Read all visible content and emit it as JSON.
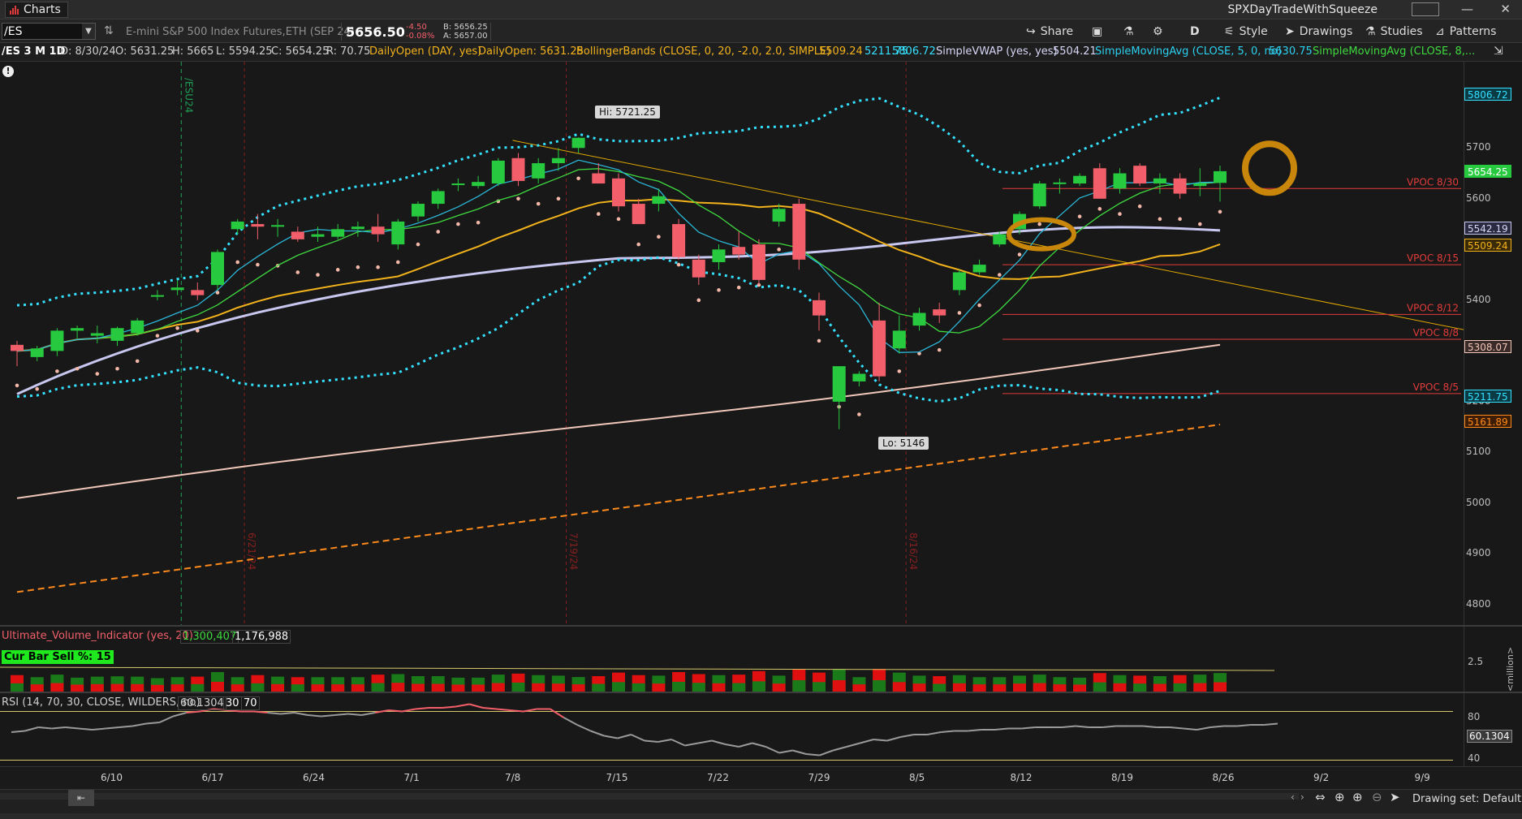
{
  "window": {
    "app_title": "Charts",
    "layout_name": "SPXDayTradeWithSqueeze",
    "minimize": "—",
    "close": "✕"
  },
  "toolbar": {
    "symbol": "/ES",
    "description": "E-mini S&P 500 Index Futures,ETH (SEP 24)",
    "last": "5656.50",
    "change": "-4.50",
    "change_pct": "-0.08%",
    "bid": "B: 5656.25",
    "ask": "A: 5657.00",
    "share": "Share",
    "period": "D",
    "style": "Style",
    "drawings": "Drawings",
    "studies": "Studies",
    "patterns": "Patterns"
  },
  "studybar": {
    "aggregation": "/ES 3 M 1D",
    "date": "D: 8/30/24",
    "open": "O: 5631.25",
    "high": "H: 5665",
    "low": "L: 5594.25",
    "close": "C: 5654.25",
    "range": "R: 70.75",
    "daily_open_study": "DailyOpen (DAY, yes)",
    "daily_open_value": "DailyOpen: 5631.25",
    "bb_study": "BollingerBands (CLOSE, 0, 20, -2.0, 2.0, SIMPLE)",
    "bb_mid": "5509.24",
    "bb_low": "5211.75",
    "bb_up": "5806.72",
    "vwap_study": "SimpleVWAP (yes, yes)",
    "vwap_value": "5504.21",
    "sma5_study": "SimpleMovingAvg (CLOSE, 5, 0, no)",
    "sma5_value": "5630.75",
    "sma8_study": "SimpleMovingAvg (CLOSE, 8,..."
  },
  "annotations": {
    "hi": "Hi: 5721.25",
    "lo": "Lo: 5146",
    "expiry": "/ESU24",
    "v1": "6/21/24",
    "v2": "7/19/24",
    "v3": "8/16/24",
    "alert": "!"
  },
  "vpoc": [
    {
      "label": "VPOC 8/30",
      "price": 5620
    },
    {
      "label": "VPOC 8/15",
      "price": 5470
    },
    {
      "label": "VPOC 8/12",
      "price": 5372
    },
    {
      "label": "VPOC 8/8",
      "price": 5323
    },
    {
      "label": "VPOC 8/5",
      "price": 5216
    }
  ],
  "price_axis": {
    "ticks": [
      5800,
      5700,
      5600,
      5500,
      5400,
      5300,
      5200,
      5100,
      5000,
      4900,
      4800
    ],
    "tags": [
      {
        "text": "5806.72",
        "price": 5806.72,
        "bg": "#0a3a44",
        "fg": "#34e1ff",
        "border": "#34e1ff"
      },
      {
        "text": "5654.25",
        "price": 5654.25,
        "bg": "#27c93f",
        "fg": "#ffffff",
        "border": "#27c93f"
      },
      {
        "text": "5542.19",
        "price": 5542.19,
        "bg": "#2a2a40",
        "fg": "#d6d6f6",
        "border": "#c7c7ef"
      },
      {
        "text": "5509.24",
        "price": 5509.24,
        "bg": "#3a2a05",
        "fg": "#f2b21c",
        "border": "#f2b21c"
      },
      {
        "text": "5308.07",
        "price": 5308.07,
        "bg": "#3a2a28",
        "fg": "#f0c6b8",
        "border": "#f0c6b8"
      },
      {
        "text": "5211.75",
        "price": 5211.75,
        "bg": "#0a3a44",
        "fg": "#34e1ff",
        "border": "#34e1ff"
      },
      {
        "text": "5161.89",
        "price": 5161.89,
        "bg": "#3d1e05",
        "fg": "#ff8a1c",
        "border": "#ff8a1c"
      }
    ]
  },
  "chart_data": {
    "type": "candlestick",
    "ylim": [
      4760,
      5870
    ],
    "x_labels": [
      "6/10",
      "6/17",
      "6/24",
      "7/1",
      "7/8",
      "7/15",
      "7/22",
      "7/29",
      "8/5",
      "8/12",
      "8/19",
      "8/26",
      "9/2",
      "9/9"
    ],
    "candles": [
      {
        "o": 5312,
        "h": 5320,
        "l": 5270,
        "c": 5300
      },
      {
        "o": 5288,
        "h": 5310,
        "l": 5280,
        "c": 5305
      },
      {
        "o": 5300,
        "h": 5345,
        "l": 5290,
        "c": 5340
      },
      {
        "o": 5340,
        "h": 5350,
        "l": 5325,
        "c": 5345
      },
      {
        "o": 5330,
        "h": 5350,
        "l": 5315,
        "c": 5335
      },
      {
        "o": 5320,
        "h": 5348,
        "l": 5310,
        "c": 5345
      },
      {
        "o": 5335,
        "h": 5365,
        "l": 5330,
        "c": 5360
      },
      {
        "o": 5410,
        "h": 5420,
        "l": 5400,
        "c": 5410
      },
      {
        "o": 5420,
        "h": 5440,
        "l": 5410,
        "c": 5425
      },
      {
        "o": 5420,
        "h": 5435,
        "l": 5400,
        "c": 5410
      },
      {
        "o": 5430,
        "h": 5500,
        "l": 5420,
        "c": 5495
      },
      {
        "o": 5540,
        "h": 5560,
        "l": 5530,
        "c": 5555
      },
      {
        "o": 5550,
        "h": 5570,
        "l": 5520,
        "c": 5545
      },
      {
        "o": 5545,
        "h": 5560,
        "l": 5525,
        "c": 5548
      },
      {
        "o": 5535,
        "h": 5545,
        "l": 5515,
        "c": 5520
      },
      {
        "o": 5525,
        "h": 5545,
        "l": 5515,
        "c": 5530
      },
      {
        "o": 5525,
        "h": 5550,
        "l": 5520,
        "c": 5540
      },
      {
        "o": 5540,
        "h": 5555,
        "l": 5525,
        "c": 5545
      },
      {
        "o": 5545,
        "h": 5570,
        "l": 5515,
        "c": 5530
      },
      {
        "o": 5510,
        "h": 5560,
        "l": 5500,
        "c": 5555
      },
      {
        "o": 5565,
        "h": 5595,
        "l": 5555,
        "c": 5590
      },
      {
        "o": 5590,
        "h": 5620,
        "l": 5580,
        "c": 5615
      },
      {
        "o": 5630,
        "h": 5640,
        "l": 5615,
        "c": 5630
      },
      {
        "o": 5625,
        "h": 5645,
        "l": 5620,
        "c": 5633
      },
      {
        "o": 5630,
        "h": 5680,
        "l": 5625,
        "c": 5675
      },
      {
        "o": 5680,
        "h": 5690,
        "l": 5625,
        "c": 5635
      },
      {
        "o": 5640,
        "h": 5680,
        "l": 5630,
        "c": 5670
      },
      {
        "o": 5670,
        "h": 5700,
        "l": 5655,
        "c": 5680
      },
      {
        "o": 5700,
        "h": 5721,
        "l": 5690,
        "c": 5720
      },
      {
        "o": 5650,
        "h": 5670,
        "l": 5630,
        "c": 5630
      },
      {
        "o": 5640,
        "h": 5650,
        "l": 5575,
        "c": 5585
      },
      {
        "o": 5590,
        "h": 5600,
        "l": 5550,
        "c": 5550
      },
      {
        "o": 5590,
        "h": 5620,
        "l": 5575,
        "c": 5605
      },
      {
        "o": 5550,
        "h": 5560,
        "l": 5480,
        "c": 5485
      },
      {
        "o": 5480,
        "h": 5490,
        "l": 5430,
        "c": 5445
      },
      {
        "o": 5475,
        "h": 5510,
        "l": 5460,
        "c": 5500
      },
      {
        "o": 5505,
        "h": 5535,
        "l": 5480,
        "c": 5490
      },
      {
        "o": 5510,
        "h": 5520,
        "l": 5430,
        "c": 5440
      },
      {
        "o": 5555,
        "h": 5590,
        "l": 5545,
        "c": 5580
      },
      {
        "o": 5590,
        "h": 5600,
        "l": 5460,
        "c": 5480
      },
      {
        "o": 5400,
        "h": 5415,
        "l": 5340,
        "c": 5370
      },
      {
        "o": 5200,
        "h": 5262,
        "l": 5146,
        "c": 5270
      },
      {
        "o": 5240,
        "h": 5260,
        "l": 5230,
        "c": 5255
      },
      {
        "o": 5360,
        "h": 5395,
        "l": 5240,
        "c": 5250
      },
      {
        "o": 5305,
        "h": 5370,
        "l": 5295,
        "c": 5340
      },
      {
        "o": 5350,
        "h": 5385,
        "l": 5340,
        "c": 5375
      },
      {
        "o": 5382,
        "h": 5395,
        "l": 5355,
        "c": 5370
      },
      {
        "o": 5420,
        "h": 5460,
        "l": 5410,
        "c": 5455
      },
      {
        "o": 5455,
        "h": 5480,
        "l": 5450,
        "c": 5470
      },
      {
        "o": 5510,
        "h": 5535,
        "l": 5505,
        "c": 5530
      },
      {
        "o": 5540,
        "h": 5575,
        "l": 5530,
        "c": 5570
      },
      {
        "o": 5585,
        "h": 5635,
        "l": 5580,
        "c": 5630
      },
      {
        "o": 5630,
        "h": 5640,
        "l": 5610,
        "c": 5632
      },
      {
        "o": 5630,
        "h": 5650,
        "l": 5625,
        "c": 5645
      },
      {
        "o": 5660,
        "h": 5670,
        "l": 5600,
        "c": 5600
      },
      {
        "o": 5620,
        "h": 5660,
        "l": 5610,
        "c": 5650
      },
      {
        "o": 5665,
        "h": 5670,
        "l": 5625,
        "c": 5630
      },
      {
        "o": 5630,
        "h": 5650,
        "l": 5610,
        "c": 5640
      },
      {
        "o": 5640,
        "h": 5650,
        "l": 5600,
        "c": 5610
      },
      {
        "o": 5625,
        "h": 5660,
        "l": 5605,
        "c": 5630
      },
      {
        "o": 5631.25,
        "h": 5665,
        "l": 5594.25,
        "c": 5654.25
      }
    ]
  },
  "volume_panel": {
    "study": "Ultimate_Volume_Indicator (yes, 20)",
    "v1": "1,300,407",
    "v2": "1,176,988",
    "cur_bar": "Cur Bar Sell %: 15",
    "axis": "2.5",
    "unit": "<million>"
  },
  "rsi_panel": {
    "study": "RSI (14, 70, 30, CLOSE, WILDERS, no)",
    "value": "60.1304",
    "low": "30",
    "high": "70",
    "ticks": [
      "80",
      "40"
    ],
    "series": [
      53,
      54,
      57,
      56,
      57,
      56,
      55,
      56,
      57,
      58,
      60,
      61,
      66,
      69,
      70,
      72,
      71,
      70,
      70,
      69,
      68,
      69,
      67,
      66,
      67,
      68,
      67,
      69,
      71,
      70,
      72,
      73,
      73,
      74,
      76,
      73,
      72,
      71,
      70,
      72,
      72,
      65,
      59,
      54,
      50,
      48,
      51,
      46,
      45,
      47,
      42,
      44,
      46,
      43,
      41,
      44,
      41,
      36,
      38,
      35,
      34,
      38,
      41,
      44,
      47,
      46,
      49,
      51,
      51,
      53,
      54,
      54,
      55,
      55,
      56,
      56,
      57,
      57,
      57,
      58,
      57,
      57,
      58,
      58,
      58,
      57,
      57,
      56,
      55,
      57,
      58,
      58,
      59,
      59,
      60
    ]
  },
  "bottombar": {
    "drawing_set": "Drawing set: Default"
  },
  "colors": {
    "up": "#27c93f",
    "down": "#f25f6a",
    "bb": "#34e1ff",
    "sma5": "#2bb6d6",
    "sma8": "#3fd93f",
    "sma20": "#f2b21c",
    "vwap": "#c7c7ef",
    "ma50": "#f0c6b8",
    "ma200": "#ff8a1c",
    "vpoc": "#e23b3b",
    "trend": "#e0a800",
    "highlight": "#c8860a"
  }
}
